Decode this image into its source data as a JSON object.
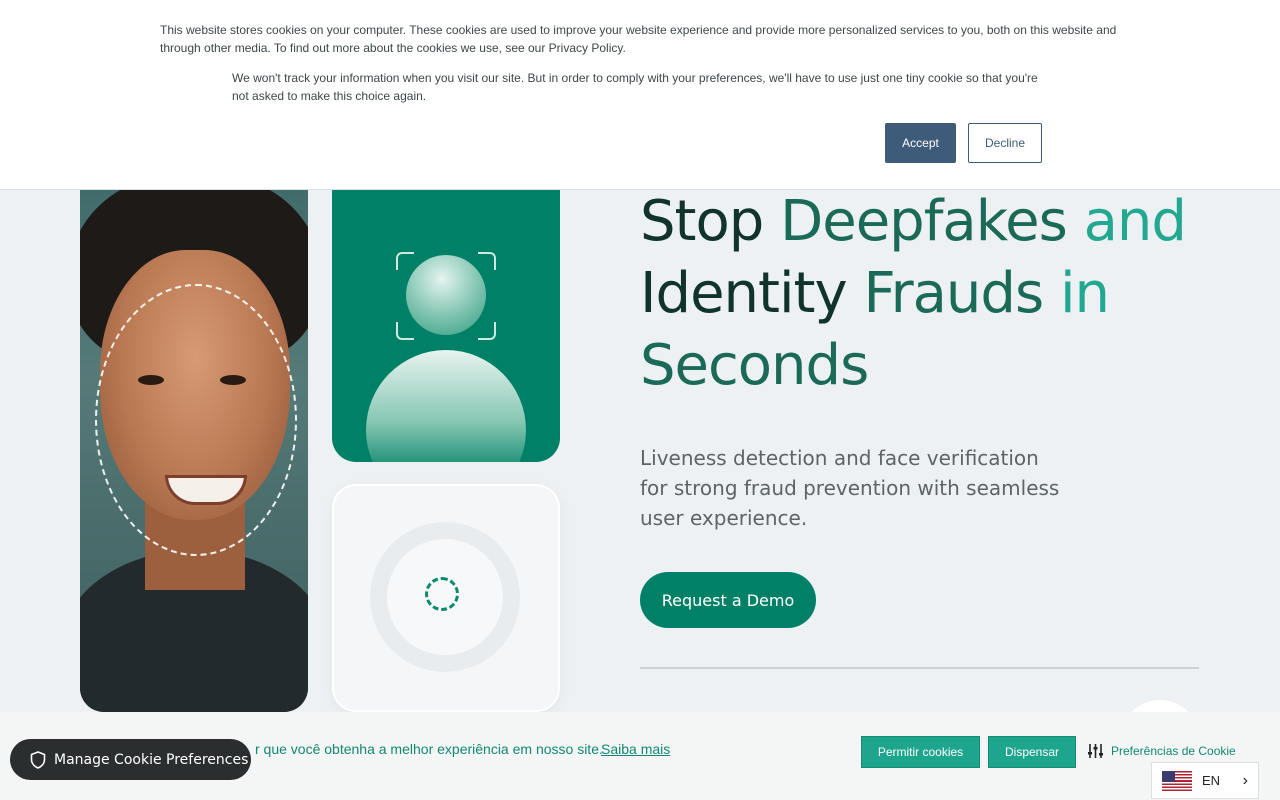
{
  "cookie_banner": {
    "text_1": "This website stores cookies on your computer. These cookies are used to improve your website experience and provide more personalized services to you, both on this website and through other media. To find out more about the cookies we use, see our Privacy Policy.",
    "text_2": "We won't track your information when you visit our site. But in order to comply with your preferences, we'll have to use just one tiny cookie so that you're not asked to make this choice again.",
    "accept_label": "Accept",
    "decline_label": "Decline"
  },
  "hero": {
    "headline_words": [
      "Stop",
      "Deepfakes",
      "and",
      "Identity",
      "Frauds",
      "in",
      "Seconds"
    ],
    "subtitle": "Liveness detection and face verification for strong fraud prevention with seamless user experience.",
    "cta_label": "Request a Demo"
  },
  "cookie_bar": {
    "text": "r que você obtenha a melhor experiência em nosso site.",
    "link": "Saiba mais",
    "allow_label": "Permitir cookies",
    "dismiss_label": "Dispensar",
    "prefs_label": "Preferências de Cookie"
  },
  "manage_pill": {
    "label": "Manage Cookie Preferences",
    "icon": "shield-icon"
  },
  "language": {
    "code": "EN",
    "flag": "us-flag-icon"
  },
  "colors": {
    "brand": "#008066",
    "accent": "#22a790",
    "banner_button": "#3f5b7a"
  }
}
